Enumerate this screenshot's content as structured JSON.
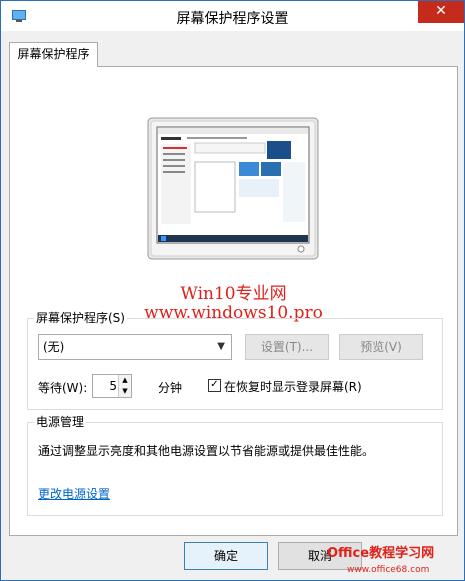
{
  "window": {
    "title": "屏幕保护程序设置",
    "close_glyph": "✕"
  },
  "tab": {
    "label": "屏幕保护程序"
  },
  "watermark": {
    "line1": "Win10专业网",
    "line2": "www.windows10.pro"
  },
  "screensaver": {
    "group_label": "屏幕保护程序(S)",
    "selected": "(无)",
    "settings_label": "设置(T)...",
    "preview_label": "预览(V)",
    "wait_label": "等待(W):",
    "wait_value": "5",
    "minutes_label": "分钟",
    "resume_checked": true,
    "resume_label": "在恢复时显示登录屏幕(R)"
  },
  "power": {
    "group_label": "电源管理",
    "description": "通过调整显示亮度和其他电源设置以节省能源或提供最佳性能。",
    "link": "更改电源设置"
  },
  "buttons": {
    "ok": "确定",
    "cancel": "取消"
  },
  "site_watermark": {
    "logo": "Office教程学习网",
    "url": "www.office68.com"
  },
  "colors": {
    "accent": "#2b6fb5",
    "close": "#c42b1c",
    "watermark": "#e0211a",
    "link": "#0066cc"
  }
}
